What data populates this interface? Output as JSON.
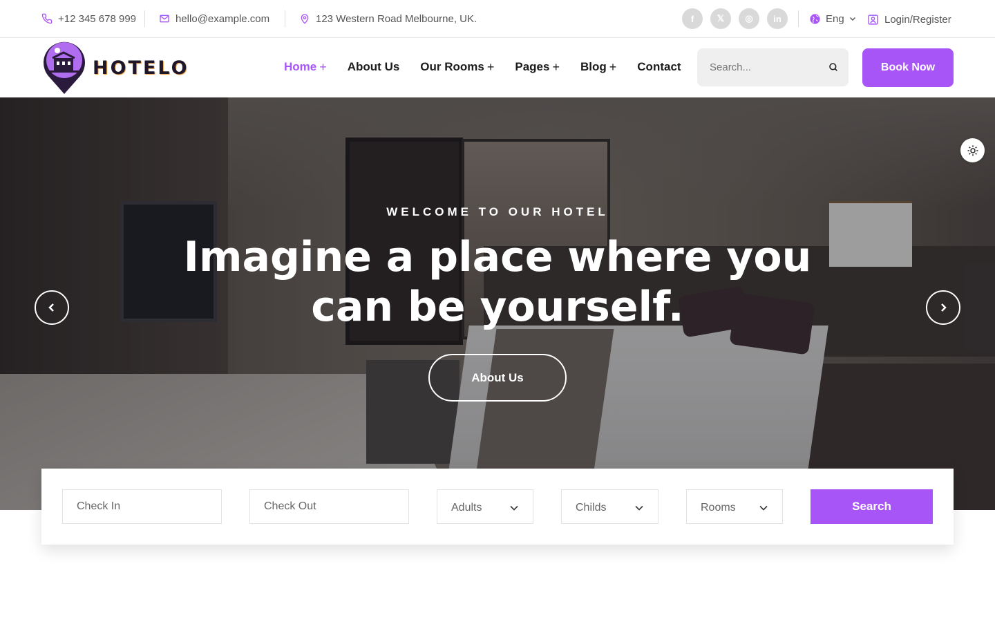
{
  "topbar": {
    "phone": "+12 345 678 999",
    "email": "hello@example.com",
    "address": "123 Western Road Melbourne, UK.",
    "social": [
      {
        "icon": "facebook-icon",
        "glyph": "f"
      },
      {
        "icon": "x-twitter-icon",
        "glyph": "𝕏"
      },
      {
        "icon": "instagram-icon",
        "glyph": "◎"
      },
      {
        "icon": "linkedin-icon",
        "glyph": "in"
      }
    ],
    "language": "Eng",
    "login": "Login/Register"
  },
  "header": {
    "logo_text": "HOTELO",
    "nav": [
      {
        "label": "Home",
        "has_submenu": true,
        "active": true
      },
      {
        "label": "About Us",
        "has_submenu": false,
        "active": false
      },
      {
        "label": "Our Rooms",
        "has_submenu": true,
        "active": false
      },
      {
        "label": "Pages",
        "has_submenu": true,
        "active": false
      },
      {
        "label": "Blog",
        "has_submenu": true,
        "active": false
      },
      {
        "label": "Contact",
        "has_submenu": false,
        "active": false
      }
    ],
    "plus": "+",
    "search_placeholder": "Search...",
    "book_now": "Book Now"
  },
  "hero": {
    "subtitle": "WELCOME TO OUR HOTEL",
    "title": "Imagine a place where you can be yourself.",
    "cta": "About Us"
  },
  "booking": {
    "check_in_placeholder": "Check In",
    "check_out_placeholder": "Check Out",
    "adults": "Adults",
    "childs": "Childs",
    "rooms": "Rooms",
    "search": "Search"
  },
  "colors": {
    "accent": "#a855f7",
    "text": "#1c1c1c",
    "muted": "#555555"
  }
}
